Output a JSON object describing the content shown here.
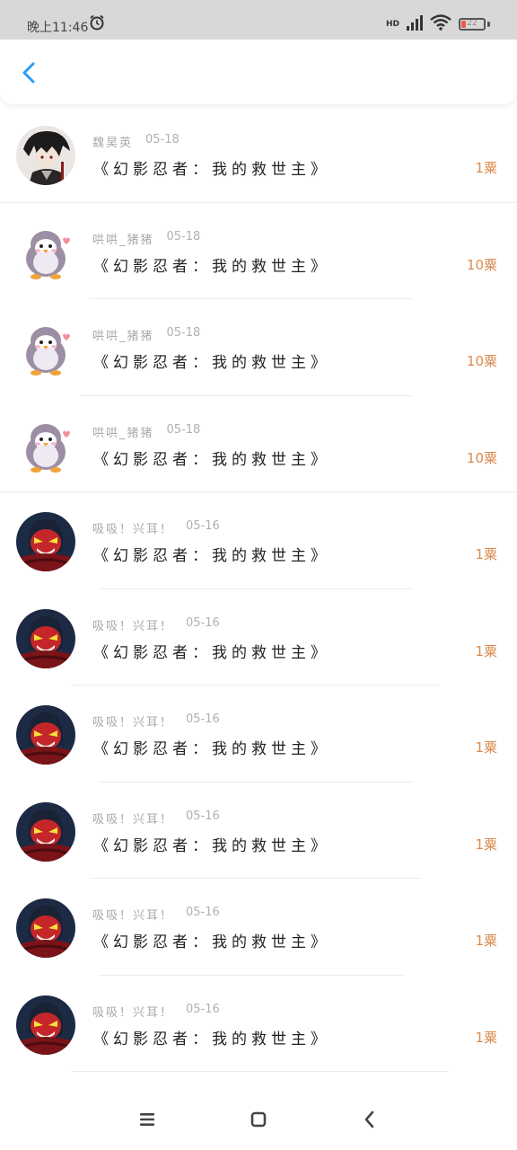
{
  "status_bar": {
    "time": "晚上11:46",
    "network": "HD",
    "battery_level": "22",
    "battery_percent": 22
  },
  "colors": {
    "accent": "#2a9df4",
    "amount": "#d98a4e",
    "meta": "#a9a9a9",
    "battery_low": "#e85a5a"
  },
  "header": {
    "back_icon": "chevron-left-icon"
  },
  "list": [
    {
      "name": "魏昊英",
      "date": "05-18",
      "title": "《幻影忍者：我的救世主》",
      "amount": "1粟",
      "avatar": "anime-boy-avatar"
    },
    {
      "name": "哄哄_猪猪",
      "date": "05-18",
      "title": "《幻影忍者：我的救世主》",
      "amount": "10粟",
      "avatar": "penguin-avatar"
    },
    {
      "name": "哄哄_猪猪",
      "date": "05-18",
      "title": "《幻影忍者：我的救世主》",
      "amount": "10粟",
      "avatar": "penguin-avatar"
    },
    {
      "name": "哄哄_猪猪",
      "date": "05-18",
      "title": "《幻影忍者：我的救世主》",
      "amount": "10粟",
      "avatar": "penguin-avatar"
    },
    {
      "name": "吸吸！兴耳！",
      "date": "05-16",
      "title": "《幻影忍者：我的救世主》",
      "amount": "1粟",
      "avatar": "red-ninja-avatar"
    },
    {
      "name": "吸吸！兴耳！",
      "date": "05-16",
      "title": "《幻影忍者：我的救世主》",
      "amount": "1粟",
      "avatar": "red-ninja-avatar"
    },
    {
      "name": "吸吸！兴耳！",
      "date": "05-16",
      "title": "《幻影忍者：我的救世主》",
      "amount": "1粟",
      "avatar": "red-ninja-avatar"
    },
    {
      "name": "吸吸！兴耳！",
      "date": "05-16",
      "title": "《幻影忍者：我的救世主》",
      "amount": "1粟",
      "avatar": "red-ninja-avatar"
    },
    {
      "name": "吸吸！兴耳！",
      "date": "05-16",
      "title": "《幻影忍者：我的救世主》",
      "amount": "1粟",
      "avatar": "red-ninja-avatar"
    },
    {
      "name": "吸吸！兴耳！",
      "date": "05-16",
      "title": "《幻影忍者：我的救世主》",
      "amount": "1粟",
      "avatar": "red-ninja-avatar"
    }
  ],
  "nav_bar": {
    "icons": [
      "menu-icon",
      "home-square-icon",
      "back-triangle-icon"
    ]
  }
}
